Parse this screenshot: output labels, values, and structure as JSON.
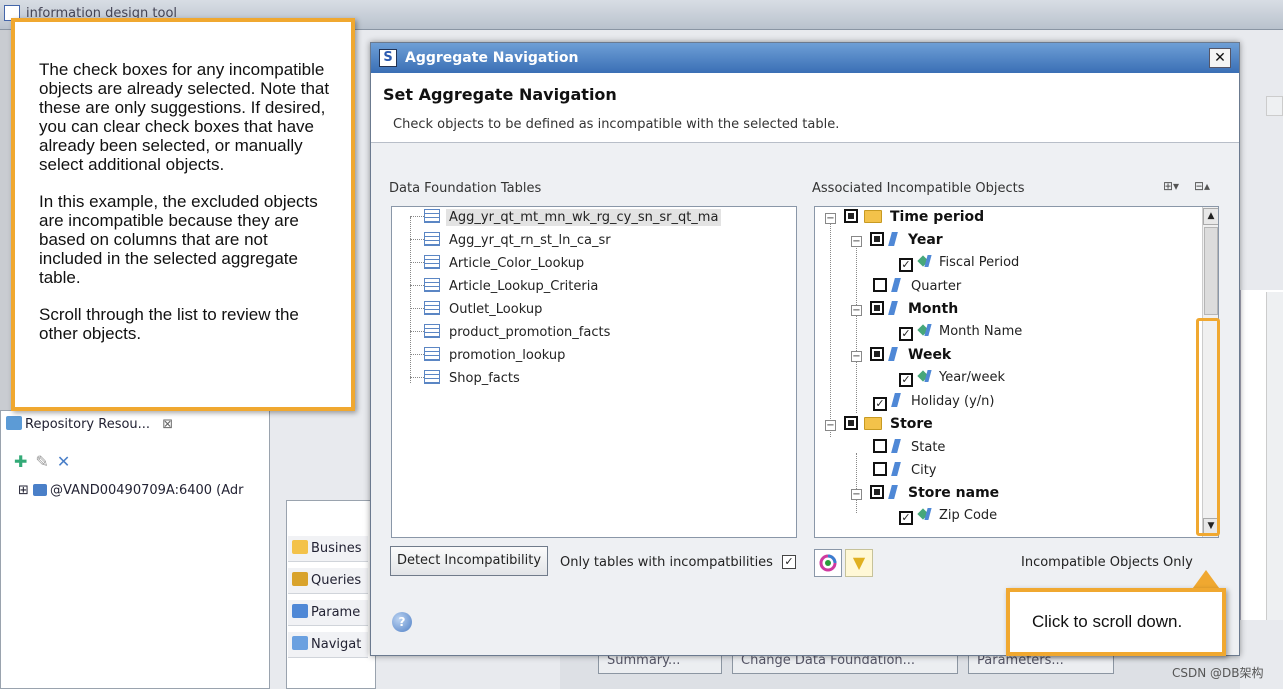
{
  "background_app": {
    "title": "information design tool",
    "repo_panel": {
      "tab_label": "Repository Resou...",
      "connection_item": "@VAND00490709A:6400 (Adr"
    },
    "side_tabs": [
      "Busines",
      "Queries",
      "Parame",
      "Navigat"
    ],
    "bottom_buttons": [
      "Summary...",
      "Change Data Foundation...",
      "Parameters..."
    ]
  },
  "callout_left": {
    "paragraphs": [
      "The check boxes for any incompatible objects are already selected. Note that these are only suggestions. If desired, you can clear check boxes that have already been selected, or manually select additional objects.",
      "In this example, the excluded objects are incompatible because they are based on columns that are not included in the selected aggregate table.",
      "Scroll through the list to review the other objects."
    ]
  },
  "callout_bottom": {
    "text": "Click to scroll down."
  },
  "dialog": {
    "title": "Aggregate Navigation",
    "close_glyph": "✕",
    "heading": "Set Aggregate Navigation",
    "subheading": "Check objects to be defined as incompatible with the selected table.",
    "tables_panel_label": "Data Foundation Tables",
    "objects_panel_label": "Associated Incompatible Objects",
    "tables": [
      {
        "name": "Agg_yr_qt_mt_mn_wk_rg_cy_sn_sr_qt_ma",
        "selected": true
      },
      {
        "name": "Agg_yr_qt_rn_st_ln_ca_sr",
        "selected": false
      },
      {
        "name": "Article_Color_Lookup",
        "selected": false
      },
      {
        "name": "Article_Lookup_Criteria",
        "selected": false
      },
      {
        "name": "Outlet_Lookup",
        "selected": false
      },
      {
        "name": "product_promotion_facts",
        "selected": false
      },
      {
        "name": "promotion_lookup",
        "selected": false
      },
      {
        "name": "Shop_facts",
        "selected": false
      }
    ],
    "objects": {
      "time_period": "Time period",
      "year": "Year",
      "fiscal_period": "Fiscal Period",
      "quarter": "Quarter",
      "month": "Month",
      "month_name": "Month Name",
      "week": "Week",
      "year_week": "Year/week",
      "holiday": "Holiday (y/n)",
      "store": "Store",
      "state": "State",
      "city": "City",
      "store_name": "Store name",
      "zip_code": "Zip Code"
    },
    "detect_button": "Detect Incompatibility",
    "only_tables_label": "Only tables with incompatbilities",
    "incompatible_only_label": "Incompatible Objects Only",
    "check_glyph": "✓",
    "collapse_glyph": "−",
    "help_glyph": "?"
  },
  "watermark": "CSDN @DB架构",
  "colors": {
    "callout_border": "#f0a830",
    "dialog_title_bar": "#3a6fb5",
    "selection": "#e3e3e3"
  }
}
